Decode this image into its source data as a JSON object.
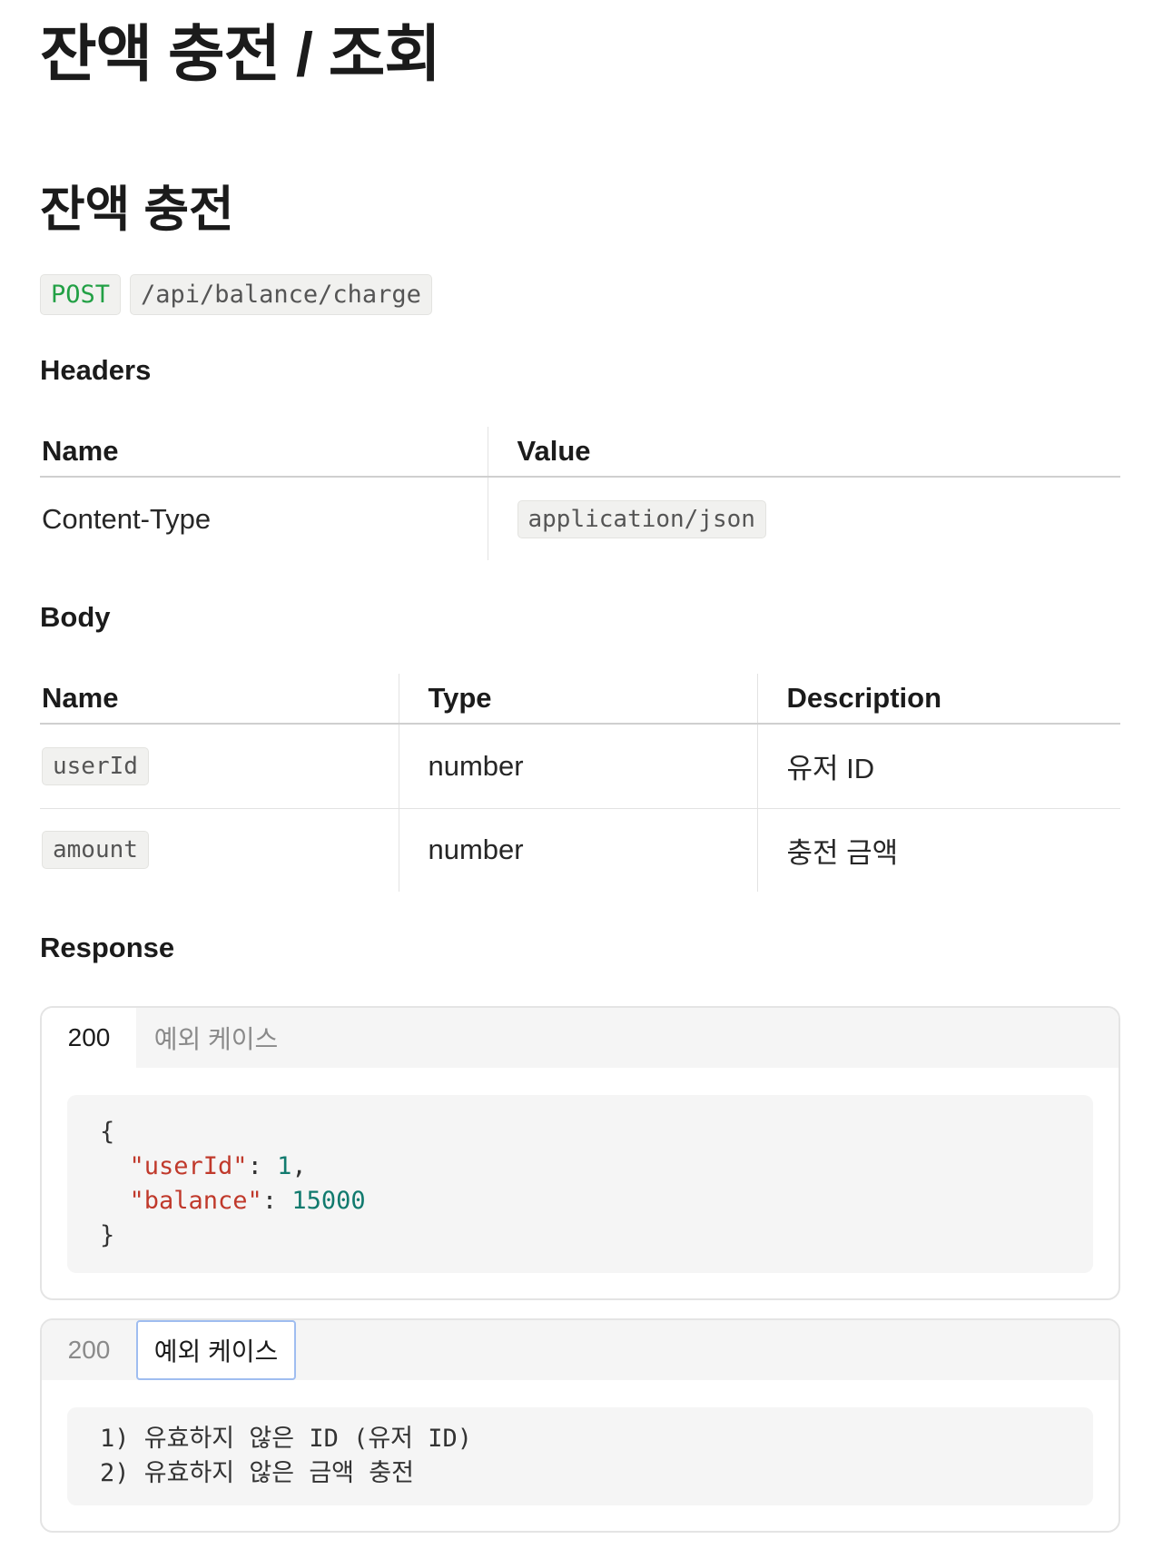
{
  "page": {
    "title": "잔액 충전 / 조회"
  },
  "section": {
    "title": "잔액 충전",
    "method": "POST",
    "endpoint": "/api/balance/charge"
  },
  "headers": {
    "heading": "Headers",
    "columns": [
      "Name",
      "Value"
    ],
    "rows": [
      {
        "name": "Content-Type",
        "value": "application/json"
      }
    ]
  },
  "body": {
    "heading": "Body",
    "columns": [
      "Name",
      "Type",
      "Description"
    ],
    "rows": [
      {
        "name": "userId",
        "type": "number",
        "description": "유저 ID"
      },
      {
        "name": "amount",
        "type": "number",
        "description": "충전 금액"
      }
    ]
  },
  "response": {
    "heading": "Response",
    "tab_success": "200",
    "tab_error": "예외 케이스",
    "success_code": {
      "open": "{",
      "key1": "\"userId\"",
      "val1": "1",
      "key2": "\"balance\"",
      "val2": "15000",
      "close": "}"
    },
    "error_lines": [
      "1) 유효하지 않은 ID (유저 ID)",
      "2) 유효하지 않은 금액 충전"
    ]
  }
}
